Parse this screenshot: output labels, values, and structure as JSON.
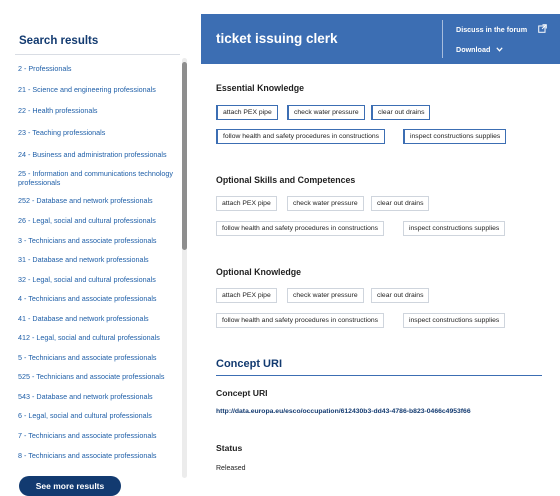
{
  "sidebar": {
    "title": "Search results",
    "items": [
      "2 - Professionals",
      "21 - Science and engineering professionals",
      "22 - Health professionals",
      "23 - Teaching professionals",
      "24 - Business and administration professionals",
      "25 - Information and communications technology professionals",
      "252 - Database and network professionals",
      "26 - Legal, social and cultural professionals",
      "3 - Technicians and associate professionals",
      "31 - Database and network professionals",
      "32 - Legal, social and cultural professionals",
      "4 - Technicians and associate professionals",
      "41 - Database and network professionals",
      "412 - Legal, social and cultural professionals",
      "5 - Technicians and associate professionals",
      "525 - Technicians and associate professionals",
      "543 - Database and network professionals",
      "6 - Legal, social and cultural professionals",
      "7 - Technicians and associate professionals",
      "8 - Technicians and associate professionals"
    ],
    "see_more": "See more results"
  },
  "header": {
    "title": "ticket issuing clerk",
    "forum_link": "Discuss in the forum",
    "download_label": "Download"
  },
  "sections": {
    "essential_knowledge": {
      "title": "Essential Knowledge",
      "chips": [
        "attach PEX pipe",
        "check water pressure",
        "clear out drains",
        "follow health and safety procedures in constructions",
        "inspect constructions supplies"
      ]
    },
    "optional_skills": {
      "title": "Optional Skills and Competences",
      "chips": [
        "attach PEX pipe",
        "check water pressure",
        "clear out drains",
        "follow health and safety procedures in constructions",
        "inspect constructions supplies"
      ]
    },
    "optional_knowledge": {
      "title": "Optional Knowledge",
      "chips": [
        "attach PEX pipe",
        "check water pressure",
        "clear out drains",
        "follow health and safety procedures in constructions",
        "inspect constructions supplies"
      ]
    }
  },
  "concept": {
    "heading": "Concept URI",
    "label": "Concept URI",
    "uri": "http://data.europa.eu/esco/occupation/612430b3-dd43-4786-b823-0466c4953f66"
  },
  "status": {
    "label": "Status",
    "value": "Released"
  },
  "colors": {
    "header_blue": "#3c6eb3",
    "navy": "#123a70",
    "link_blue": "#1f5fa8"
  }
}
